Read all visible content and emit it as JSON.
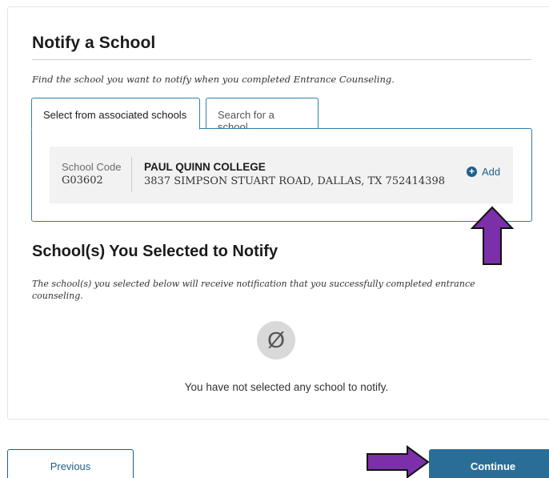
{
  "notify": {
    "title": "Notify a School",
    "instructions": "Find the school you want to notify when you completed Entrance Counseling.",
    "tabs": [
      {
        "label": "Select from associated schools",
        "active": true
      },
      {
        "label": "Search for a school",
        "active": false
      }
    ],
    "school": {
      "code_label": "School Code",
      "code": "G03602",
      "name": "PAUL QUINN COLLEGE",
      "address": "3837 SIMPSON STUART ROAD, DALLAS, TX 752414398",
      "add_label": "Add",
      "add_icon": "plus-circle-icon"
    }
  },
  "selected": {
    "title": "School(s) You Selected to Notify",
    "note": "The school(s) you selected below will receive notification that you successfully completed entrance counseling.",
    "empty_icon": "empty-set-icon",
    "empty_glyph": "Ø",
    "empty_message": "You have not selected any school to notify."
  },
  "footer": {
    "previous_label": "Previous",
    "continue_label": "Continue"
  },
  "colors": {
    "primary": "#2a6e98",
    "link": "#1f5f8b",
    "tab_border": "#2e7fa8",
    "annotation_arrow": "#7b2fa8"
  }
}
